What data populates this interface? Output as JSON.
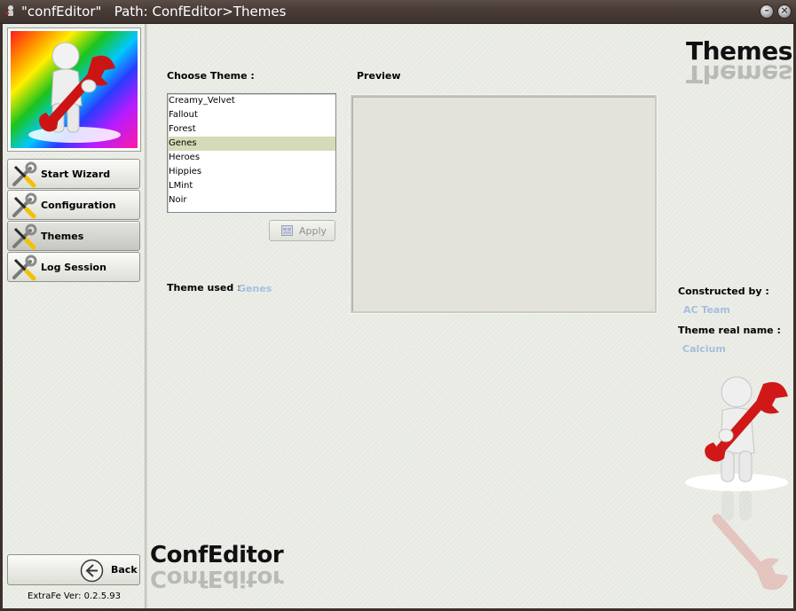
{
  "window": {
    "title": "\"confEditor\"   Path: ConfEditor>Themes"
  },
  "sidebar": {
    "items": [
      {
        "label": "Start Wizard",
        "active": false
      },
      {
        "label": "Configuration",
        "active": false
      },
      {
        "label": "Themes",
        "active": true
      },
      {
        "label": "Log Session",
        "active": false
      }
    ],
    "back_label": "Back",
    "version": "ExtraFe Ver: 0.2.5.93"
  },
  "main": {
    "page_heading": "Themes",
    "choose_theme_label": "Choose Theme :",
    "preview_label": "Preview",
    "themes": [
      "Creamy_Velvet",
      "Fallout",
      "Forest",
      "Genes",
      "Heroes",
      "Hippies",
      "LMint",
      "Noir"
    ],
    "selected_theme": "Genes",
    "apply_label": "Apply",
    "theme_used_label": "Theme used :",
    "theme_used_value": "Genes",
    "constructed_by_label": "Constructed by :",
    "constructed_by_value": "AC Team",
    "theme_real_name_label": "Theme real name :",
    "theme_real_name_value": "Calcium",
    "brand_text": "ConfEditor"
  },
  "icons": {
    "app": "app-icon",
    "nav": "tools-icon",
    "back": "back-arrow-icon",
    "apply": "apply-icon",
    "minimize": "minimize-icon",
    "close": "close-icon"
  },
  "colors": {
    "titlebar": "#4a3d38",
    "client_bg": "#e9ebe4",
    "selection": "#d6dab8",
    "soft_value": "#a8bdd6",
    "wrench_red": "#d01818"
  }
}
